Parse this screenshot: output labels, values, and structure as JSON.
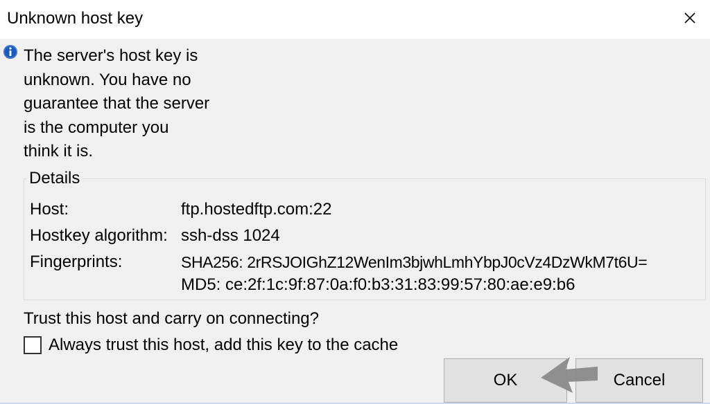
{
  "window": {
    "title": "Unknown host key",
    "close_label": "×"
  },
  "message": {
    "lines": [
      "The server's host key is",
      "unknown. You have no",
      "guarantee that the server",
      "is the computer you",
      "think it is."
    ]
  },
  "details": {
    "legend": "Details",
    "host_label": "Host:",
    "host_value": "ftp.hostedftp.com:22",
    "algorithm_label": "Hostkey algorithm:",
    "algorithm_value": "ssh-dss 1024",
    "fingerprints_label": "Fingerprints:",
    "fingerprint_sha256": "SHA256: 2rRSJOIGhZ12WenIm3bjwhLmhYbpJ0cVz4DzWkM7t6U=",
    "fingerprint_md5": "MD5: ce:2f:1c:9f:87:0a:f0:b3:31:83:99:57:80:ae:e9:b6"
  },
  "trust": {
    "question": "Trust this host and carry on connecting?",
    "checkbox_label": "Always trust this host, add this key to the cache",
    "checkbox_checked": false
  },
  "buttons": {
    "ok": "OK",
    "cancel": "Cancel"
  },
  "icons": {
    "info": "info-icon",
    "close": "close-icon",
    "pointer": "arrow-icon"
  },
  "colors": {
    "info_blue": "#1e5bb8",
    "arrow_gray": "#8a8a8a"
  }
}
